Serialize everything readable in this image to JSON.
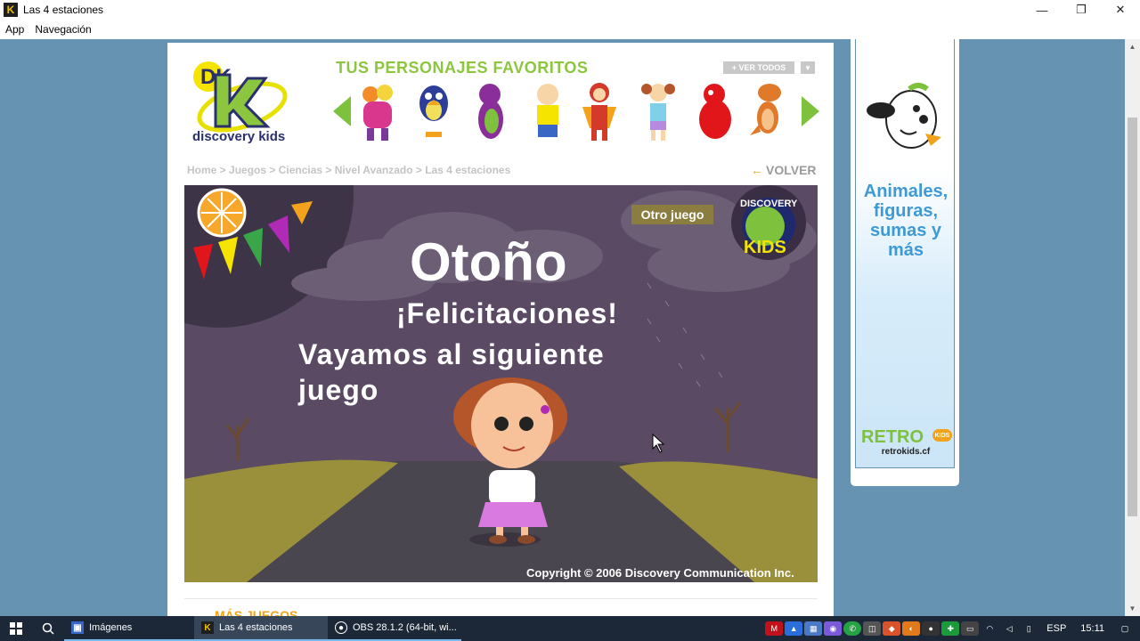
{
  "window": {
    "title": "Las 4 estaciones",
    "app_glyph": "K",
    "minimize": "—",
    "restore": "❐",
    "close": "✕"
  },
  "menu": {
    "items": [
      "App",
      "Navegación"
    ]
  },
  "header": {
    "logo_letters": "DK",
    "logo_text": "discovery kids",
    "characters_title": "TUS PERSONAJES FAVORITOS",
    "see_all": "+ VER TODOS",
    "see_all_drop": "▼"
  },
  "breadcrumb": "Home > Juegos > Ciencias > Nivel Avanzado > Las 4 estaciones",
  "back": {
    "arrow": "←",
    "label": "VOLVER"
  },
  "game": {
    "other_game": "Otro juego",
    "logo_top": "DISCOVERY",
    "logo_bottom": "KIDS",
    "season": "Otoño",
    "congrats": "¡Felicitaciones!",
    "next": "Vayamos al siguiente juego",
    "copyright": "Copyright © 2006 Discovery Communication Inc."
  },
  "more_games": "MÁS JUEGOS",
  "ad": {
    "text": "Animales, figuras, sumas y más",
    "brand": "RETRO",
    "brand_badge": "KIDS",
    "url": "retrokids.cf"
  },
  "taskbar": {
    "tasks": [
      {
        "label": "Imágenes"
      },
      {
        "label": "Las 4 estaciones"
      },
      {
        "label": "OBS 28.1.2 (64-bit, wi..."
      }
    ],
    "lang": "ESP",
    "time": "15:11"
  },
  "colors": {
    "page_bg": "#6593b1",
    "accent_green": "#7dc13c",
    "accent_orange": "#f2a31b",
    "taskbar": "#1c2837"
  }
}
